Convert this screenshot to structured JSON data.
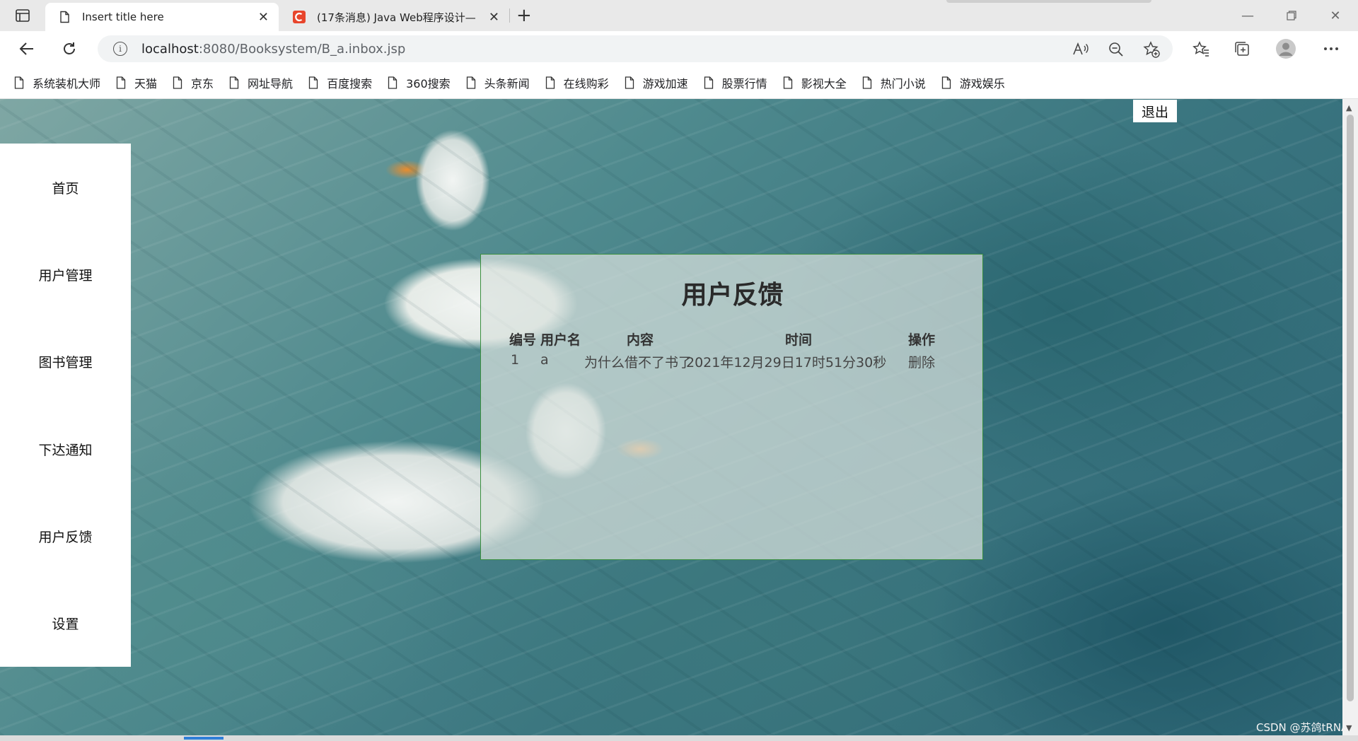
{
  "browser": {
    "tabs": [
      {
        "title": "Insert title here",
        "active": true,
        "icon": "page-icon"
      },
      {
        "title": "(17条消息) Java Web程序设计—",
        "active": false,
        "icon": "csdn-icon"
      }
    ],
    "address": {
      "host": "localhost",
      "path": ":8080/Booksystem/B_a.inbox.jsp"
    },
    "toolbar_icons": [
      "read-aloud-icon",
      "zoom-out-icon",
      "add-favorite-icon",
      "favorites-icon",
      "collections-icon",
      "profile-icon",
      "more-icon"
    ],
    "bookmarks": [
      "系统装机大师",
      "天猫",
      "京东",
      "网址导航",
      "百度搜索",
      "360搜索",
      "头条新闻",
      "在线购彩",
      "游戏加速",
      "股票行情",
      "影视大全",
      "热门小说",
      "游戏娱乐"
    ]
  },
  "page": {
    "logout_label": "退出",
    "sidebar": [
      "首页",
      "用户管理",
      "图书管理",
      "下达通知",
      "用户反馈",
      "设置"
    ],
    "panel": {
      "title": "用户反馈",
      "columns": [
        "编号",
        "用户名",
        "内容",
        "时间",
        "操作"
      ],
      "rows": [
        {
          "id": "1",
          "username": "a",
          "content": "为什么借不了书了",
          "time": "2021年12月29日17时51分30秒",
          "action": "删除"
        }
      ]
    },
    "watermark": "CSDN @苏鸽tRNA"
  },
  "colors": {
    "panel_border": "#3a8f3f",
    "accent": "#2f7fd8"
  }
}
